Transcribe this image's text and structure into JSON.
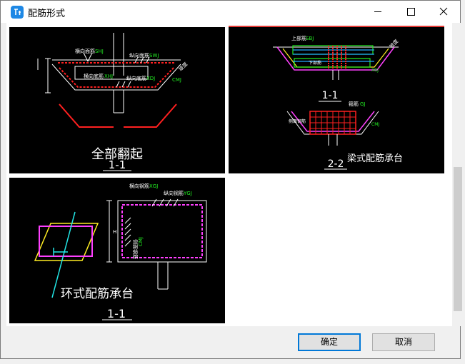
{
  "window": {
    "title": "配筋形式",
    "accent": "#1e88e5",
    "controls": [
      "minimize-icon",
      "maximize-icon",
      "close-icon"
    ]
  },
  "tiles": [
    {
      "name": "full-bend-up",
      "caption": "全部翻起",
      "section": "1-1",
      "labels": {
        "transverse_top": "横向面筋",
        "transverse_top_code": "SHJ",
        "longitudinal_top": "纵向面筋",
        "longitudinal_top_code": "SWJ",
        "transverse_bottom": "横向底筋",
        "transverse_bottom_code": "XHJ",
        "longitudinal_bottom": "纵向底筋",
        "longitudinal_bottom_code": "XDJ",
        "side_code": "CMJ",
        "slope": "坡度"
      }
    },
    {
      "name": "beam-type-pile-cap",
      "caption": "梁式配筋承台",
      "section_a": "1-1",
      "section_b": "2-2",
      "labels": {
        "top_rebar": "上部筋",
        "top_rebar_code": "SBJ",
        "side_code": "CMJ",
        "bottom_rebar": "下部筋",
        "bottom_rebar_code": "XBJ",
        "stirrup": "箍筋",
        "stirrup_code": "GJ",
        "side_rebar": "侧面钢筋",
        "side_rebar_code": "CMJ",
        "slope": "坡度"
      }
    },
    {
      "name": "ring-type-pile-cap",
      "caption": "环式配筋承台",
      "section": "1-1",
      "labels": {
        "transverse": "横向钢筋",
        "transverse_code": "XGJ",
        "longitudinal": "纵向钢筋",
        "longitudinal_code": "YGJ",
        "side": "侧面钢筋",
        "side_code": "CMJ",
        "height": "H"
      }
    }
  ],
  "footer": {
    "ok_label": "确定",
    "cancel_label": "取消"
  }
}
